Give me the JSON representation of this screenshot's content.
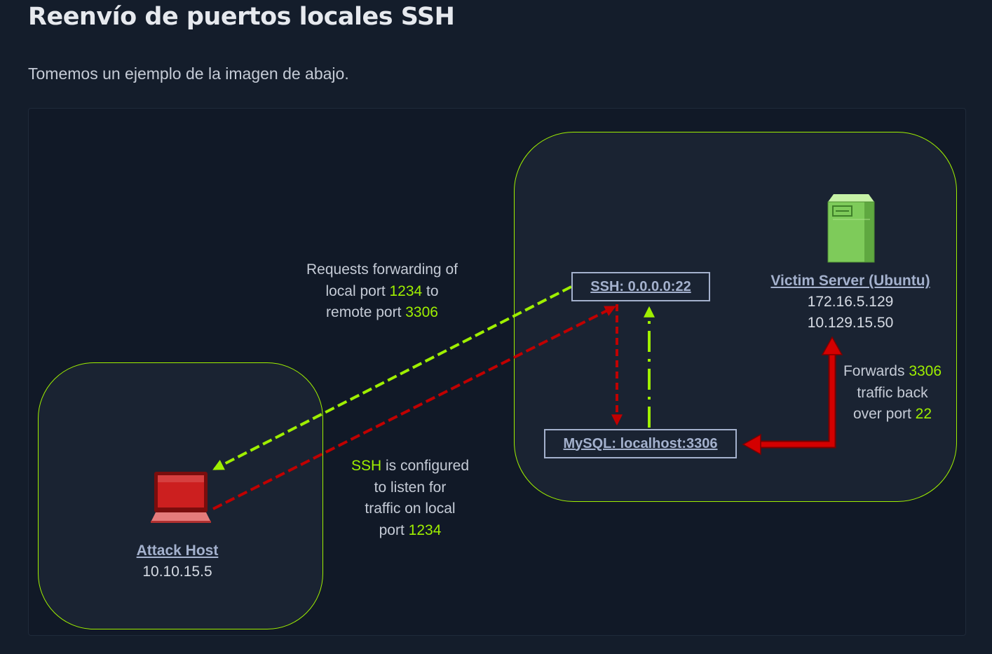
{
  "heading": "Reenvío de puertos locales SSH",
  "intro": "Tomemos un ejemplo de la imagen de abajo.",
  "diagram": {
    "nodes": {
      "ssh": "SSH: 0.0.0.0:22",
      "mysql": "MySQL: localhost:3306"
    },
    "victim": {
      "name": "Victim Server (Ubuntu)",
      "ip1": "172.16.5.129",
      "ip2": "10.129.15.50",
      "icon": "server-icon"
    },
    "attacker": {
      "name": "Attack Host",
      "ip": "10.10.15.5",
      "icon": "laptop-icon"
    },
    "notes": {
      "request": {
        "l1": "Requests forwarding of",
        "l2a": "local port ",
        "l2b": "1234",
        "l2c": " to",
        "l3a": "remote port ",
        "l3b": "3306"
      },
      "configured": {
        "l1a": "SSH",
        "l1b": " is configured",
        "l2": "to listen for",
        "l3": "traffic on local",
        "l4a": "port ",
        "l4b": "1234"
      },
      "forwards": {
        "l1a": "Forwards ",
        "l1b": "3306",
        "l2": "traffic back",
        "l3a": "over port ",
        "l3b": "22"
      }
    },
    "colors": {
      "accent": "#9fef00",
      "arrow_red": "#c00000",
      "label": "#a4b1cd",
      "background": "#141d2b"
    }
  }
}
